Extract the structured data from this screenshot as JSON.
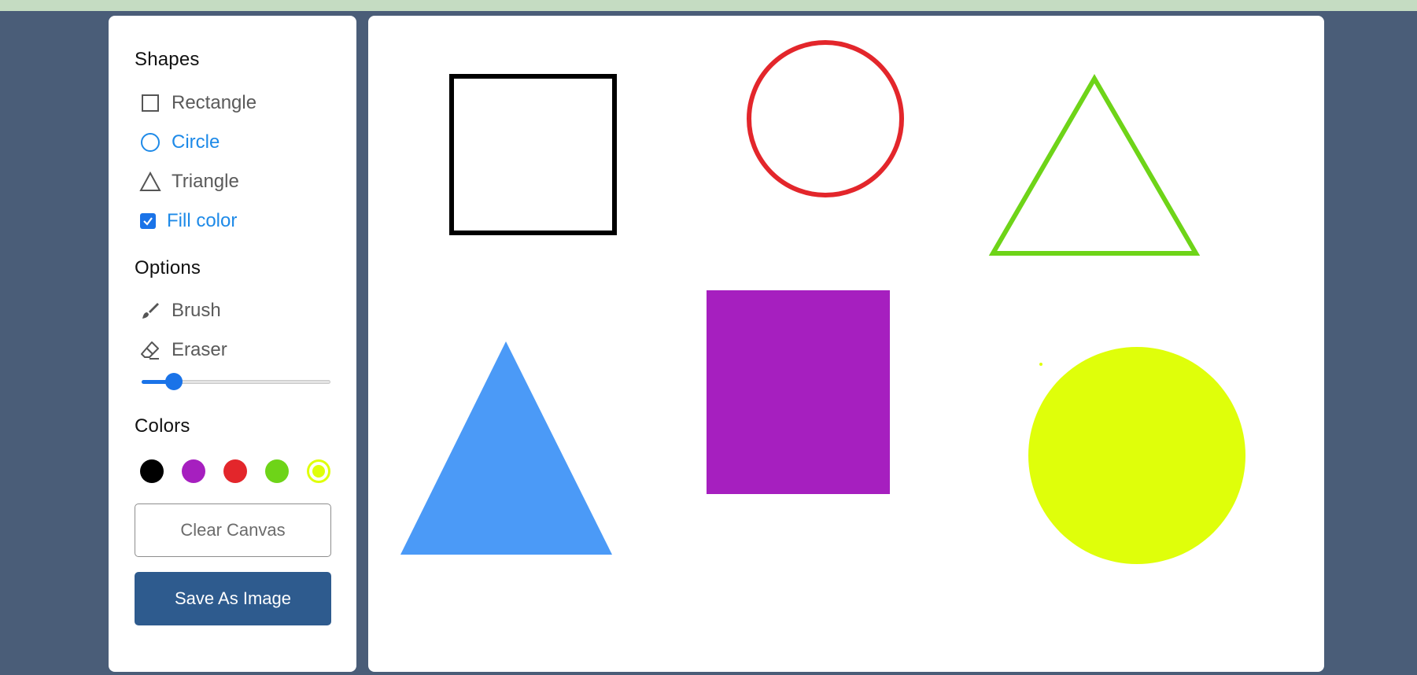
{
  "sections": {
    "shapes": "Shapes",
    "options": "Options",
    "colors": "Colors"
  },
  "shapes": {
    "rectangle": "Rectangle",
    "circle": "Circle",
    "triangle": "Triangle",
    "fill_color": "Fill color",
    "fill_color_checked": true,
    "selected": "Circle"
  },
  "options": {
    "brush": "Brush",
    "eraser": "Eraser",
    "brush_size_fraction": 0.17
  },
  "colors": [
    {
      "name": "black",
      "hex": "#000000"
    },
    {
      "name": "purple",
      "hex": "#a61fbf"
    },
    {
      "name": "red",
      "hex": "#e3262b"
    },
    {
      "name": "green",
      "hex": "#6ed418"
    },
    {
      "name": "yellow",
      "hex": "#dfff0a",
      "selected": true
    }
  ],
  "buttons": {
    "clear": "Clear Canvas",
    "save": "Save As Image"
  },
  "canvas": {
    "shapes": [
      {
        "type": "rectangle",
        "style": "outline",
        "color": "#000000"
      },
      {
        "type": "circle",
        "style": "outline",
        "color": "#e3262b"
      },
      {
        "type": "triangle",
        "style": "outline",
        "color": "#6ed418"
      },
      {
        "type": "triangle",
        "style": "filled",
        "color": "#4b9af7"
      },
      {
        "type": "rectangle",
        "style": "filled",
        "color": "#a61fbf"
      },
      {
        "type": "circle",
        "style": "filled",
        "color": "#dfff0a"
      }
    ]
  }
}
